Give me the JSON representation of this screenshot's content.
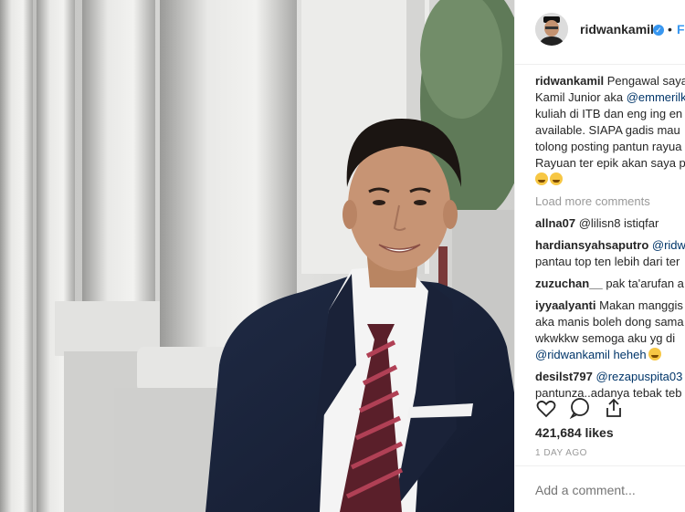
{
  "header": {
    "username": "ridwankamil",
    "follow_label": "Fo",
    "dot": "•"
  },
  "caption": {
    "username": "ridwankamil",
    "lines": [
      "Pengawal saya",
      "Kamil Junior aka ",
      "kuliah di ITB dan eng ing en",
      "available. SIAPA gadis mau",
      "tolong posting pantun rayua",
      "Rayuan ter epik akan saya p"
    ],
    "mention": "@emmerilk"
  },
  "load_more": "Load more comments",
  "comments": [
    {
      "username": "allna07",
      "lines": [
        "@lilisn8 istiqfar"
      ]
    },
    {
      "username": "hardiansyahsaputro",
      "lines": [
        "@ridw",
        "pantau top ten lebih dari ter"
      ]
    },
    {
      "username": "zuzuchan__",
      "lines": [
        "pak ta'arufan a"
      ]
    },
    {
      "username": "iyyaalyanti",
      "lines": [
        "Makan manggis",
        "aka manis boleh dong sama",
        "wkwkkw semoga aku yg di",
        "@ridwankamil heheh"
      ]
    },
    {
      "username": "desilst797",
      "lines": [
        "@rezapuspita03",
        "pantunza..adanya tebak teb"
      ]
    }
  ],
  "likes": "421,684 likes",
  "time": "1 DAY AGO",
  "add_comment_placeholder": "Add a comment...",
  "icons": {
    "like": "heart-icon",
    "comment": "speech-bubble-icon",
    "share": "share-icon",
    "verified": "verified-badge-icon"
  },
  "colors": {
    "link": "#003569",
    "accent": "#3897f0",
    "muted": "#999999"
  }
}
